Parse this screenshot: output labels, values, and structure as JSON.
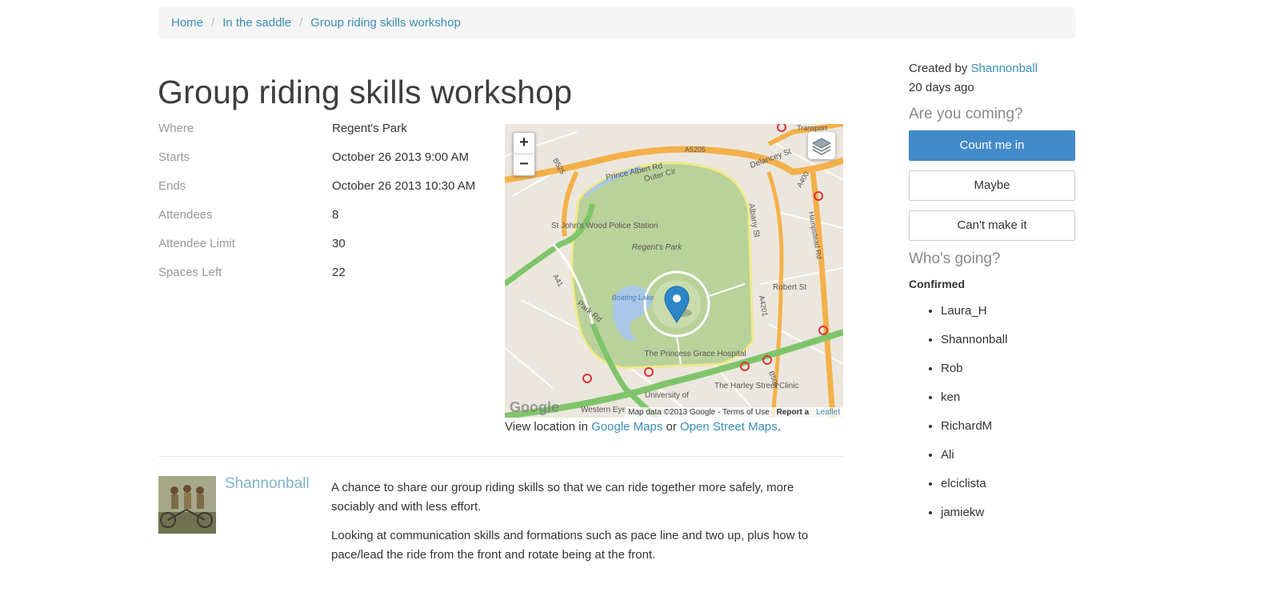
{
  "breadcrumb": {
    "items": [
      "Home",
      "In the saddle",
      "Group riding skills workshop"
    ],
    "separator": "/"
  },
  "page_title": "Group riding skills workshop",
  "details": [
    {
      "label": "Where",
      "value": "Regent's Park"
    },
    {
      "label": "Starts",
      "value": "October 26 2013 9:00 AM"
    },
    {
      "label": "Ends",
      "value": "October 26 2013 10:30 AM"
    },
    {
      "label": "Attendees",
      "value": "8"
    },
    {
      "label": "Attendee Limit",
      "value": "30"
    },
    {
      "label": "Spaces Left",
      "value": "22"
    }
  ],
  "map": {
    "zoom_in": "+",
    "zoom_out": "−",
    "attribution": "Map data ©2013 Google - Terms of Use",
    "report": "Report a",
    "leaflet": "Leaflet",
    "watermark": "Google",
    "labels": {
      "park": "Regent's Park",
      "prince_albert": "Prince Albert Rd",
      "outer_circle": "Outer Cir",
      "boating_lake": "Boating Lake",
      "police": "St John's Wood Police Station",
      "hospital": "The Princess Grace Hospital",
      "clinic": "The Harley Street Clinic",
      "robert_st": "Robert St",
      "albany_st": "Albany St",
      "hampstead_rd": "Hampstead Rd",
      "delancey_st": "Delancey St",
      "park_rd": "Park Rd",
      "a41": "A41",
      "a5205": "A5205",
      "b525": "B525",
      "a4201": "A4201",
      "b506": "B506",
      "a400": "A400",
      "university": "University of",
      "western_eye": "Western Eye",
      "transport": "Transport"
    },
    "colors": {
      "park": "#b9d29a",
      "major_road": "#f4b04a",
      "green_road": "#7fc46b",
      "water": "#a9c8e8",
      "marker": "#2c86c9"
    }
  },
  "view_location": {
    "prefix": "View location in",
    "google": "Google Maps",
    "or": "or",
    "osm": "Open Street Maps",
    "suffix": "."
  },
  "description": {
    "author": "Shannonball",
    "paragraphs": [
      "A chance to share our group riding skills so that we can ride together more safely, more sociably and with less effort.",
      "Looking at communication skills and formations such as pace line and two up, plus how to pace/lead the ride from the front and rotate being at the front."
    ]
  },
  "sidebar": {
    "created_prefix": "Created by",
    "creator": "Shannonball",
    "created_ago": "20 days ago",
    "coming_heading": "Are you coming?",
    "buttons": {
      "yes": "Count me in",
      "maybe": "Maybe",
      "no": "Can't make it"
    },
    "going_heading": "Who's going?",
    "confirmed_label": "Confirmed",
    "attendees": [
      "Laura_H",
      "Shannonball",
      "Rob",
      "ken",
      "RichardM",
      "Ali",
      "elciclista",
      "jamiekw"
    ]
  },
  "colors": {
    "link": "#3a8fb7",
    "primary_button": "#428bca",
    "breadcrumb_bg": "#f5f5f5"
  }
}
